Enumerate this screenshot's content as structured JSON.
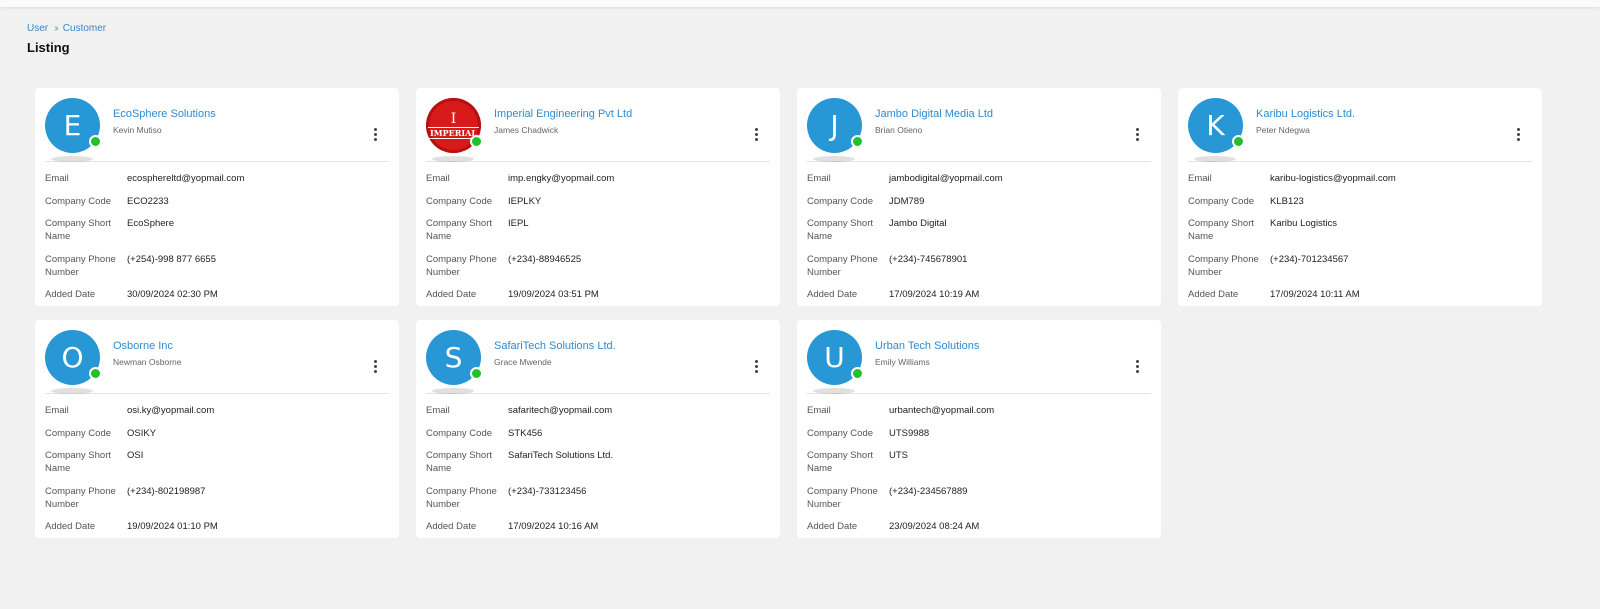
{
  "breadcrumb": {
    "items": [
      "User",
      "Customer"
    ]
  },
  "page": {
    "title": "Listing"
  },
  "labels": {
    "email": "Email",
    "company_code": "Company Code",
    "company_short_name": "Company Short Name",
    "company_phone": "Company Phone Number",
    "added_date": "Added Date"
  },
  "colors": {
    "accent": "#2f8ad0",
    "avatar": "#2797d5",
    "online": "#21c12a",
    "logo": "#d91a1a"
  },
  "cards": [
    {
      "initial": "E",
      "logo": null,
      "name": "EcoSphere Solutions",
      "contact": "Kevin Mutiso",
      "email": "ecosphereltd@yopmail.com",
      "code": "ECO2233",
      "short": "EcoSphere",
      "phone": "(+254)-998 877 6655",
      "date": "30/09/2024 02:30 PM"
    },
    {
      "initial": "",
      "logo": {
        "pillar": "I",
        "word": "IMPERIAL"
      },
      "name": "Imperial Engineering Pvt Ltd",
      "contact": "James Chadwick",
      "email": "imp.engky@yopmail.com",
      "code": "IEPLKY",
      "short": "IEPL",
      "phone": "(+234)-88946525",
      "date": "19/09/2024 03:51 PM"
    },
    {
      "initial": "J",
      "logo": null,
      "name": "Jambo Digital Media Ltd",
      "contact": "Brian Otieno",
      "email": "jambodigital@yopmail.com",
      "code": "JDM789",
      "short": "Jambo Digital",
      "phone": "(+234)-745678901",
      "date": "17/09/2024 10:19 AM"
    },
    {
      "initial": "K",
      "logo": null,
      "name": "Karibu Logistics Ltd.",
      "contact": "Peter Ndegwa",
      "email": "karibu-logistics@yopmail.com",
      "code": "KLB123",
      "short": "Karibu Logistics",
      "phone": "(+234)-701234567",
      "date": "17/09/2024 10:11 AM"
    },
    {
      "initial": "O",
      "logo": null,
      "name": "Osborne Inc",
      "contact": "Newman Osborne",
      "email": "osi.ky@yopmail.com",
      "code": "OSIKY",
      "short": "OSI",
      "phone": "(+234)-802198987",
      "date": "19/09/2024 01:10 PM"
    },
    {
      "initial": "S",
      "logo": null,
      "name": "SafariTech Solutions Ltd.",
      "contact": "Grace Mwende",
      "email": "safaritech@yopmail.com",
      "code": "STK456",
      "short": "SafariTech Solutions Ltd.",
      "phone": "(+234)-733123456",
      "date": "17/09/2024 10:16 AM"
    },
    {
      "initial": "U",
      "logo": null,
      "name": "Urban Tech Solutions",
      "contact": "Emily Williams",
      "email": "urbantech@yopmail.com",
      "code": "UTS9988",
      "short": "UTS",
      "phone": "(+234)-234567889",
      "date": "23/09/2024 08:24 AM"
    }
  ]
}
